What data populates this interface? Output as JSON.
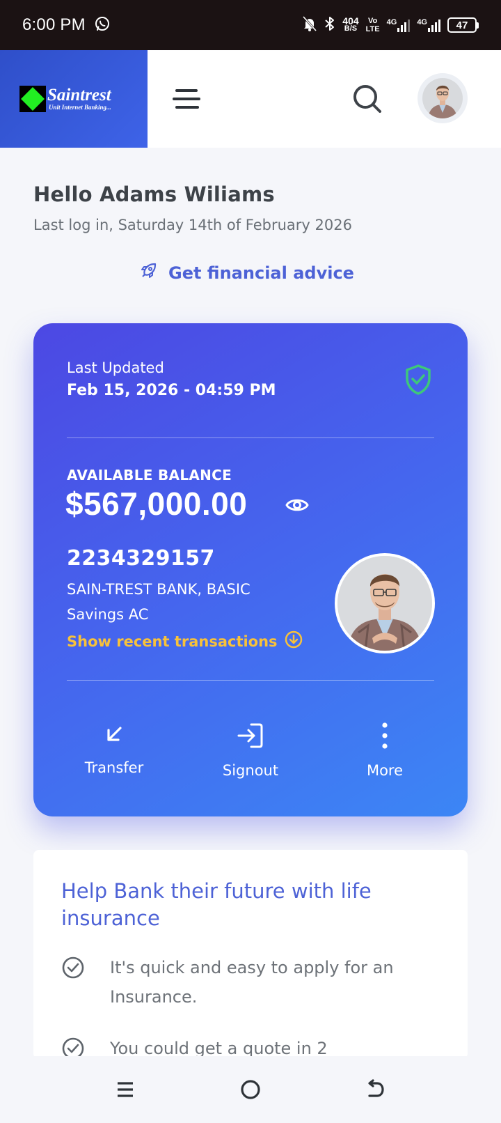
{
  "status_bar": {
    "time": "6:00 PM",
    "net_speed_value": "404",
    "net_speed_unit": "B/S",
    "volte_top": "Vo",
    "volte_bottom": "LTE",
    "network_1": "4G",
    "network_2": "4G",
    "battery": "47"
  },
  "header": {
    "logo_name": "Saintrest",
    "logo_tagline": "Unit Internet Banking...",
    "icons": [
      "menu-icon",
      "search-icon"
    ]
  },
  "greeting": {
    "title": "Hello Adams Wiliams",
    "last_login": "Last log in, Saturday 14th of February 2026",
    "advice_label": "Get financial advice"
  },
  "balance_card": {
    "last_updated_label": "Last Updated",
    "last_updated_value": "Feb 15, 2026 - 04:59 PM",
    "available_label": "AVAILABLE BALANCE",
    "balance": "$567,000.00",
    "account_number": "2234329157",
    "bank_name": "SAIN-TREST BANK, BASIC",
    "account_type": "Savings AC",
    "recent_link": "Show recent transactions",
    "actions": [
      {
        "label": "Transfer",
        "icon": "arrow-down-left-icon"
      },
      {
        "label": "Signout",
        "icon": "sign-in-icon"
      },
      {
        "label": "More",
        "icon": "more-vertical-icon"
      }
    ]
  },
  "insurance": {
    "title": "Help Bank their future with life insurance",
    "items": [
      "It's quick and easy to apply for an Insurance.",
      "You could get a quote in 2"
    ]
  },
  "colors": {
    "accent": "#4d62d6",
    "card_gradient_start": "#4c48e3",
    "card_gradient_end": "#3c86f5",
    "link_yellow": "#f8c23a",
    "shield_green": "#3ec77a"
  }
}
